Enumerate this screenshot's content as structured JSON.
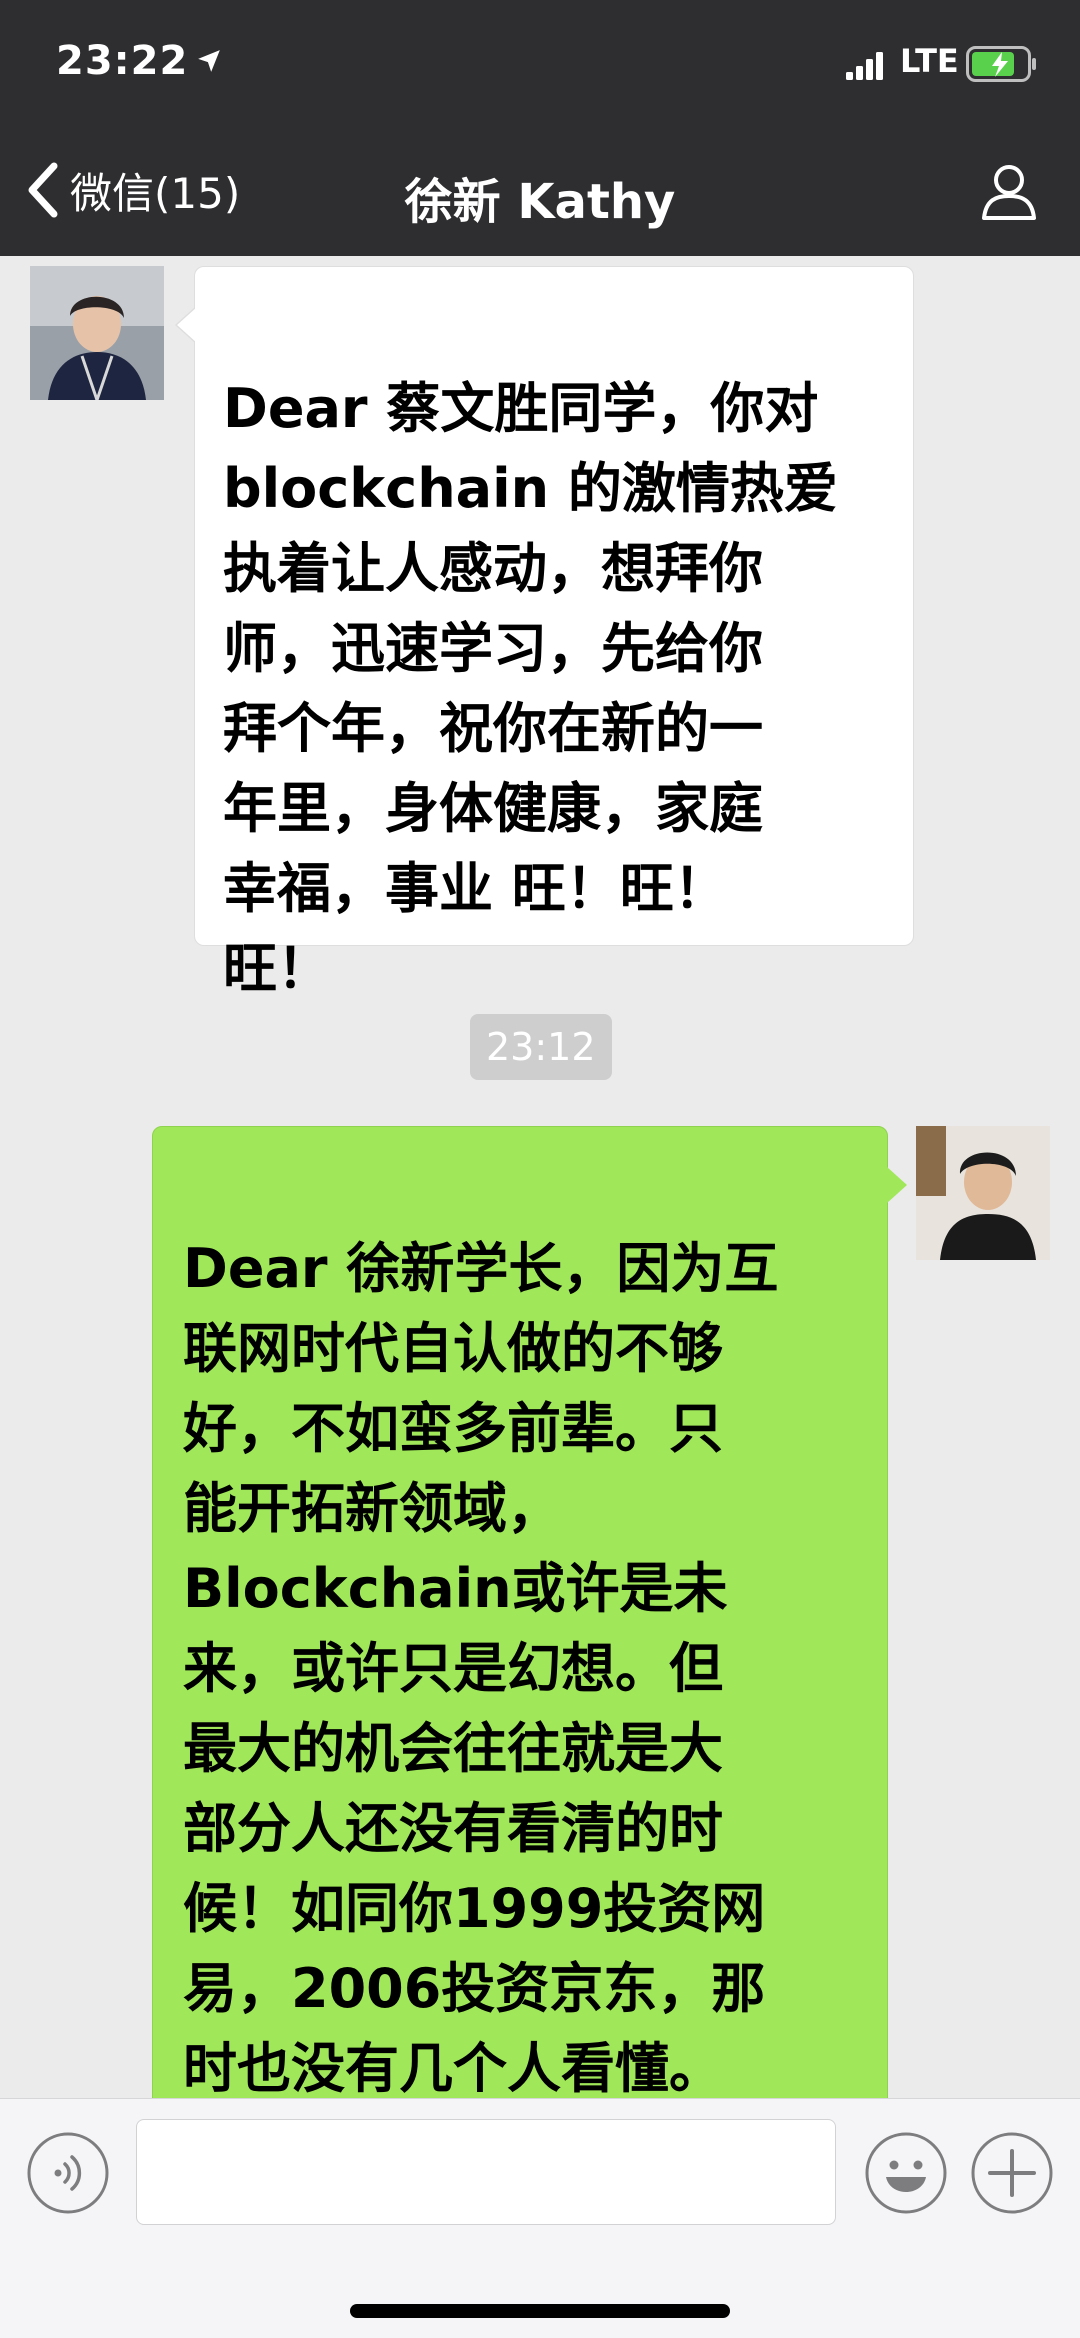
{
  "status_bar": {
    "time": "23:22",
    "network": "LTE",
    "icons": [
      "location-arrow-icon",
      "signal-icon",
      "battery-charging-icon"
    ]
  },
  "nav": {
    "back_label": "微信(15)",
    "title": "徐新 Kathy",
    "icons": [
      "chevron-left-icon",
      "person-icon"
    ]
  },
  "messages": [
    {
      "direction": "incoming",
      "text": "Dear 蔡文胜同学，你对\nblockchain 的激情热爱\n执着让人感动，想拜你\n师，迅速学习，先给你\n拜个年，祝你在新的一\n年里，身体健康，家庭\n幸福，事业 旺！旺！\n旺！"
    },
    {
      "direction": "timestamp",
      "text": "23:12"
    },
    {
      "direction": "outgoing",
      "text": "Dear 徐新学长，因为互\n联网时代自认做的不够\n好，不如蛮多前辈。只\n能开拓新领域，\nBlockchain或许是未\n来，或许只是幻想。但\n最大的机会往往就是大\n部分人还没有看清的时\n候！如同你1999投资网\n易，2006投资京东，那\n时也没有几个人看懂。",
      "emoji": "handshake-icon"
    }
  ],
  "input_bar": {
    "value": "",
    "icons": [
      "voice-icon",
      "emoji-icon",
      "plus-icon"
    ]
  },
  "colors": {
    "topbar": "#2e2e30",
    "chat_background": "#ebebeb",
    "incoming_bubble": "#ffffff",
    "outgoing_bubble": "#a0e75a",
    "timestamp_pill": "#cecece"
  }
}
